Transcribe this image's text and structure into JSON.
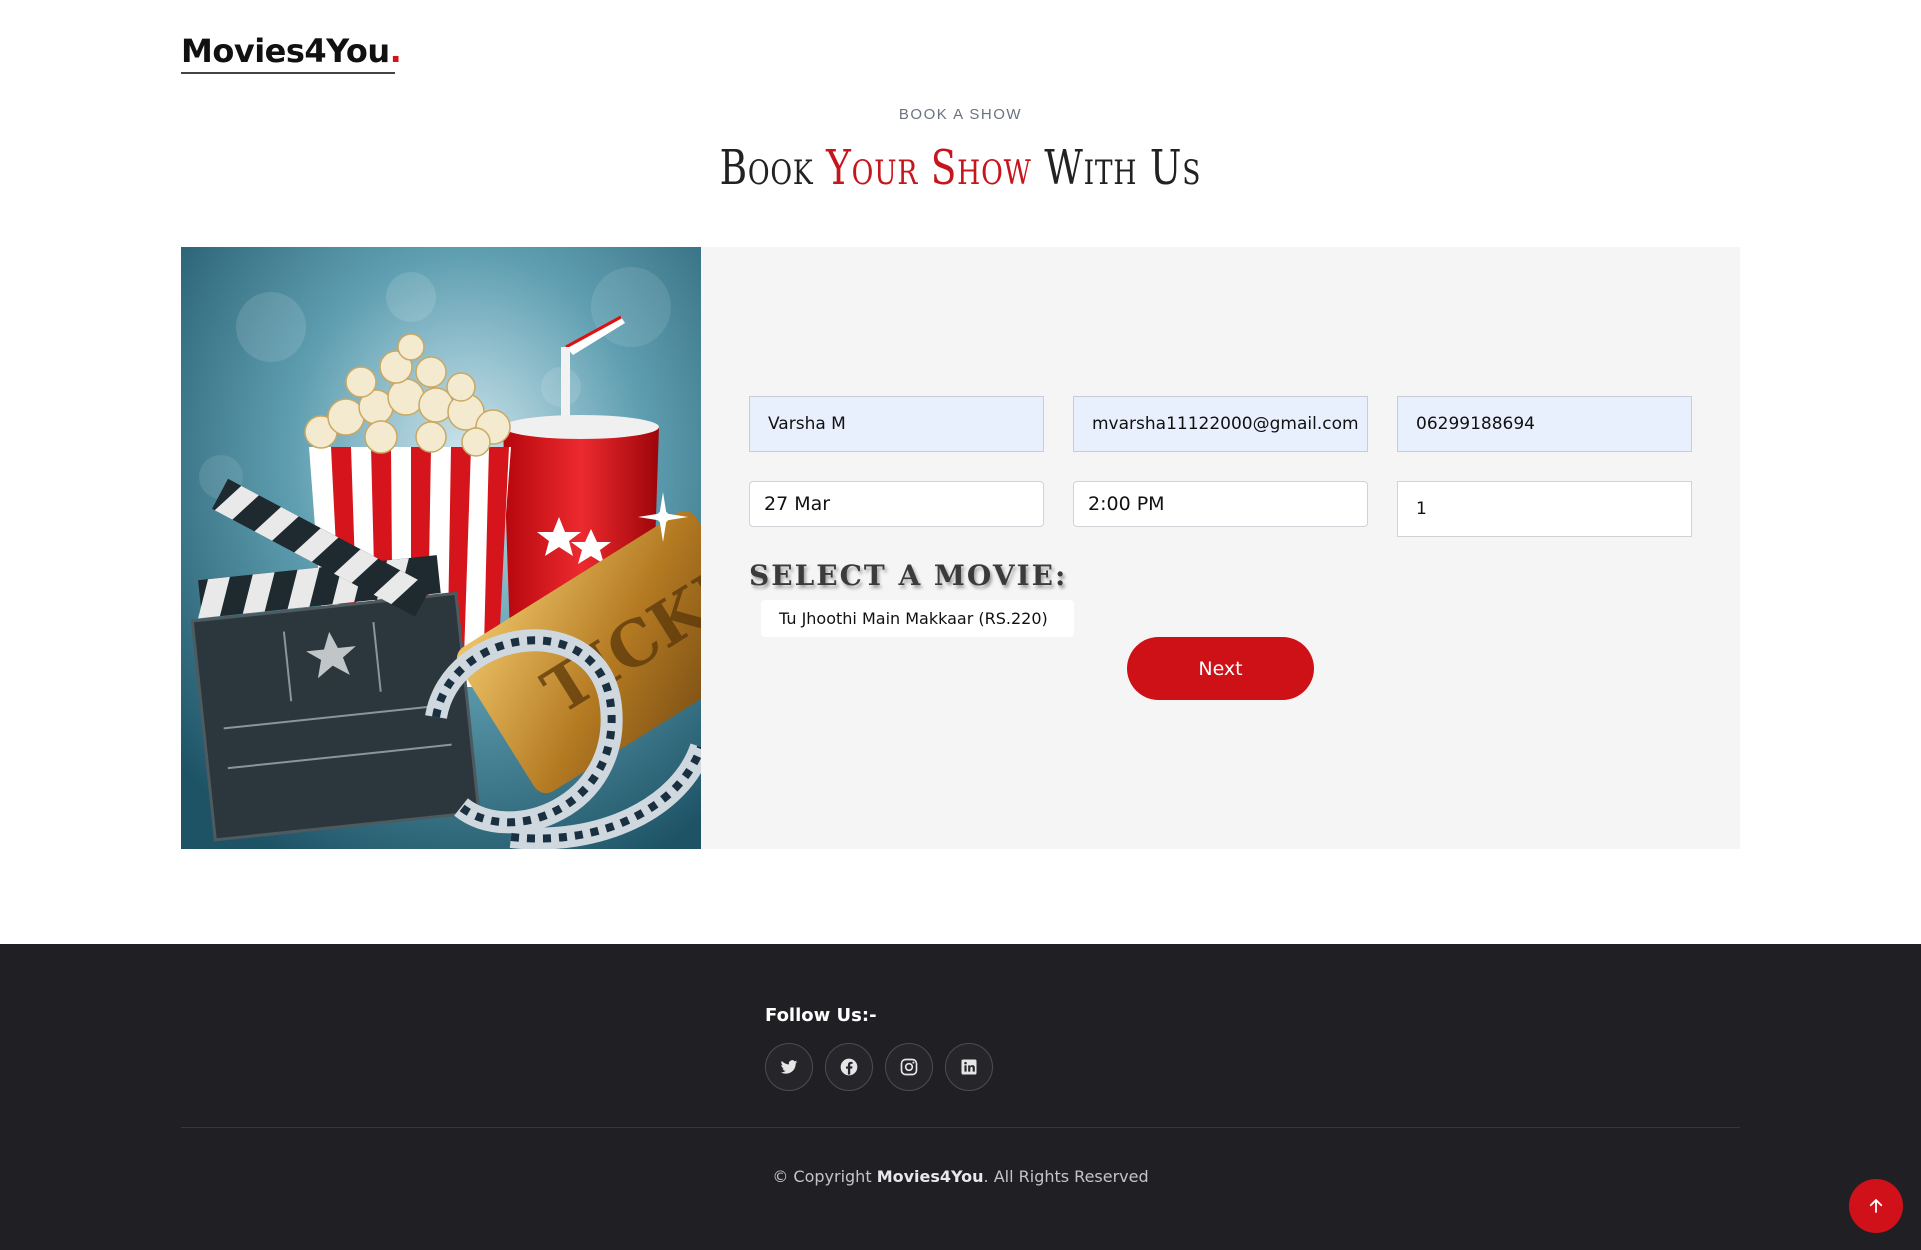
{
  "brand": {
    "name": "Movies4You",
    "dot": "."
  },
  "section": {
    "eyebrow": "BOOK A SHOW",
    "title_part1": "Book ",
    "title_accent": "Your Show",
    "title_part2": " With Us"
  },
  "form": {
    "name": "Varsha M",
    "email": "mvarsha11122000@gmail.com",
    "phone": "06299188694",
    "date": "27 Mar",
    "time": "2:00 PM",
    "quantity": "1",
    "select_movie_label": "SELECT A MOVIE:",
    "selected_movie": "Tu Jhoothi Main Makkaar (RS.220)",
    "next_label": "Next"
  },
  "footer": {
    "follow_label": "Follow Us:-",
    "socials": [
      "twitter-icon",
      "facebook-icon",
      "instagram-icon",
      "linkedin-icon"
    ],
    "copyright_prefix": "© Copyright ",
    "copyright_brand": "Movies4You",
    "copyright_suffix": ". All Rights Reserved"
  },
  "colors": {
    "accent": "#cd1117",
    "footer_bg": "#202024",
    "card_bg": "#f5f5f5",
    "autofill_bg": "#e8f0fe"
  }
}
